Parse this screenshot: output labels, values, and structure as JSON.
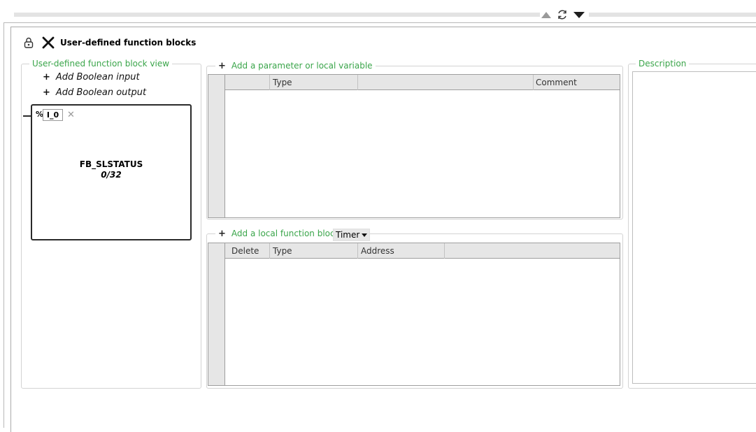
{
  "header": {
    "title": "User-defined function blocks"
  },
  "fb_view": {
    "legend": "User-defined function block view",
    "add_input_label": "Add Boolean input",
    "add_output_label": "Add Boolean output",
    "pin_prefix": "%",
    "pin_value": "I_0",
    "block_name": "FB_SLSTATUS",
    "block_count": "0/32"
  },
  "params": {
    "legend": "Add a parameter or local variable",
    "columns": [
      "",
      "Type",
      "Comment"
    ]
  },
  "local_fb": {
    "legend": "Add a local function block",
    "selected_type": "Timer",
    "columns": [
      "Delete",
      "Type",
      "Address"
    ]
  },
  "description": {
    "legend": "Description"
  }
}
